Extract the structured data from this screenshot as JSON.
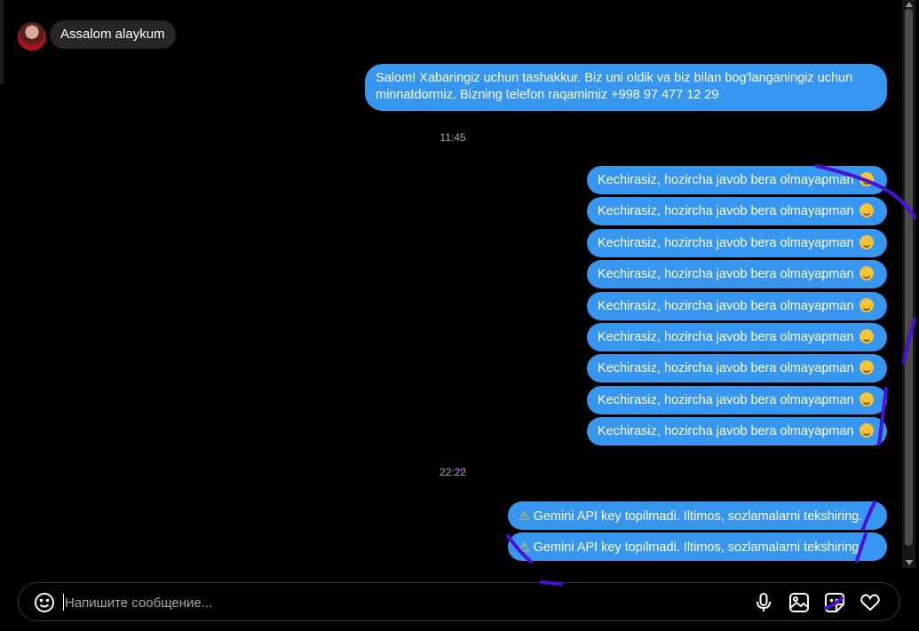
{
  "incoming": {
    "text": "Assalom alaykum"
  },
  "outgoing_first": {
    "text": "Salom! Xabaringiz uchun tashakkur. Biz uni oldik va biz bilan bog'langaningiz uchun minnatdormiz. Bizning telefon raqamimiz +998 97 477 12 29"
  },
  "timestamps": [
    "11:45",
    "22:22"
  ],
  "apology_text": "Kechirasiz, hozircha javob bera olmayapman",
  "apology_emoji": "smiling-face-emoji",
  "apology_count": 9,
  "gemini_text": "Gemini API key topilmadi. Iltimos, sozlamalarni tekshiring.",
  "gemini_count": 2,
  "composer": {
    "placeholder": "Напишите сообщение...",
    "icons": [
      "smiley-icon",
      "microphone-icon",
      "image-icon",
      "sticker-icon",
      "heart-icon"
    ]
  },
  "colors": {
    "outgoing": "#3797f0",
    "incoming": "#262626",
    "background": "#000000",
    "scribble": "#4b0fd6"
  }
}
